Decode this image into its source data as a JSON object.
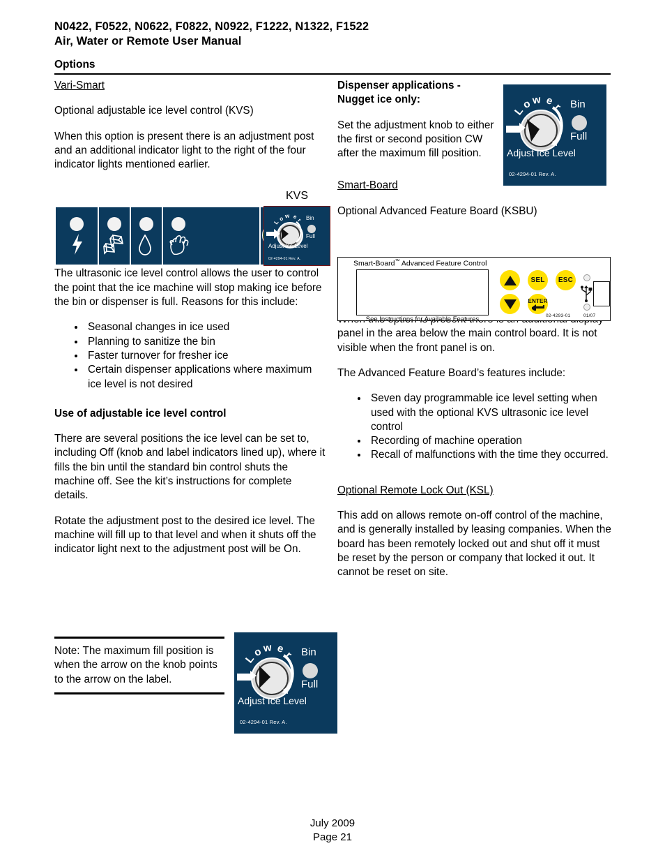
{
  "header": {
    "models": "N0422, F0522, N0622, F0822, N0922, F1222, N1322, F1522",
    "subtitle": "Air, Water or Remote User Manual",
    "section": "Options"
  },
  "left": {
    "heading_varismart": "Vari-Smart",
    "p1": "Optional adjustable ice level control (KVS)",
    "p2": "When this option is present there is an adjustment post and an additional indicator light to the right of the four indicator lights mentioned earlier.",
    "kvs_caption": "KVS",
    "p3": "The ultrasonic ice level control allows the user to control the point that the ice machine will stop making ice before the bin or dispenser is full. Reasons for this include:",
    "bullets": [
      "Seasonal changes in ice used",
      "Planning to sanitize the bin",
      "Faster turnover for fresher ice",
      "Certain dispenser applications where maximum ice level is not desired"
    ],
    "heading_use": "Use of adjustable ice level control",
    "p4": "There are several positions the ice level can be set to, including Off (knob and label indicators lined up), where it fills the bin until the standard bin control shuts the machine off. See the kit’s instructions for complete details.",
    "p5": "Rotate the adjustment post to the desired ice level. The machine will fill up to that level and when it shuts off the indicator light next to the adjustment post will be On.",
    "note": "Note: The maximum fill position is when the arrow on the knob points to the arrow on the label."
  },
  "right": {
    "heading_dispenser": "Dispenser applications - Nugget ice only:",
    "p1": "Set the adjustment knob to either the first or second position CW after the maximum fill position.",
    "heading_smartboard": "Smart-Board",
    "p2": "Optional Advanced Feature Board (KSBU)",
    "p3": "When this option is present there is an additional display panel in the area below the main control board. It is not visible when the front panel is on.",
    "p4": "The Advanced Feature Board’s features include:",
    "bullets": [
      "Seven day programmable ice level setting when used with the optional KVS ultrasonic ice level control",
      "Recording of machine operation",
      "Recall of malfunctions with the time they occurred."
    ],
    "heading_ksl": "Optional Remote Lock Out (KSL)",
    "p5": "This add on allows remote on-off control of the machine, and is generally installed by leasing companies. When the board has been remotely locked out and shut off it must be reset by the person or company that locked it out. It cannot be reset on site."
  },
  "control_panel": {
    "lamps": [
      {
        "icon": "lightning-bolt-icon"
      },
      {
        "icon": "ice-cubes-icon"
      },
      {
        "icon": "water-drop-icon"
      },
      {
        "icon": "cleaning-hand-icon"
      }
    ],
    "power_on_button": "on-button-green",
    "power_off_button": "off-button-red"
  },
  "knob_label": {
    "lower": "Lower",
    "lower_letters": [
      "L",
      "o",
      "w",
      "e",
      "r"
    ],
    "bin": "Bin",
    "full": "Full",
    "adjust": "Adjust Ice Level",
    "part_number": "02-4294-01 Rev. A."
  },
  "smart_board": {
    "title": "Smart-Board",
    "title_tm": "™",
    "title_rest": " Advanced Feature Control",
    "footer": "See Instructions for Available Features",
    "buttons": {
      "up": "▲",
      "down": "▼",
      "sel": "SEL",
      "esc": "ESC",
      "enter": "ENTER"
    },
    "part_number": "02-4293-01",
    "date_code": "01/07"
  },
  "footer": {
    "date": "July 2009",
    "page": "Page 21"
  },
  "colors": {
    "panel_blue": "#0b3a5d",
    "button_yellow": "#ffe000",
    "on_green": "#00903d",
    "off_red": "#e8201c"
  }
}
